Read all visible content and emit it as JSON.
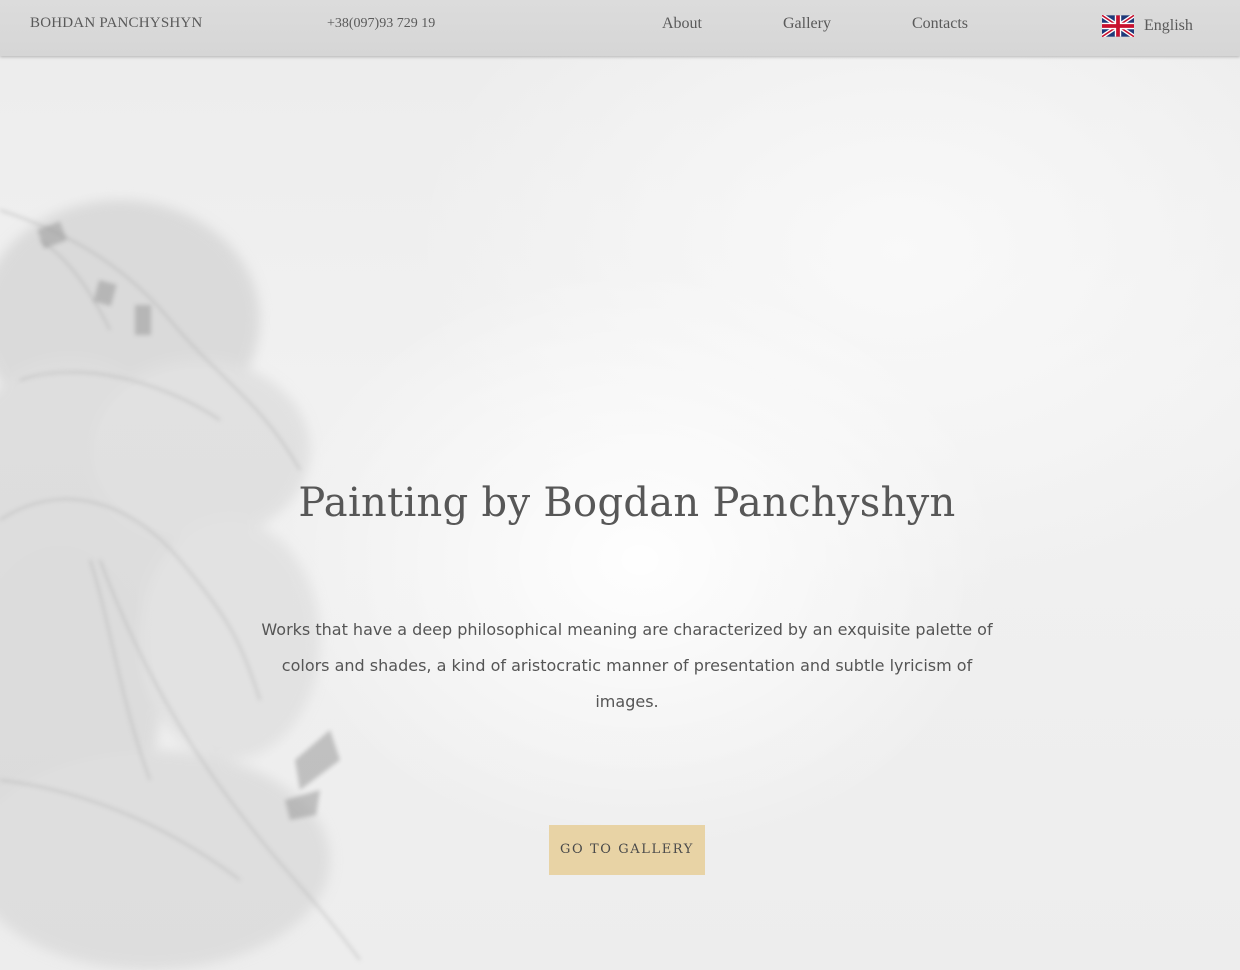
{
  "header": {
    "brand": "BOHDAN PANCHYSHYN",
    "phone": "+38(097)93 729 19",
    "nav": [
      {
        "label": "About"
      },
      {
        "label": "Gallery"
      },
      {
        "label": "Contacts"
      }
    ],
    "language": {
      "label": "English",
      "icon": "uk-flag-icon"
    }
  },
  "hero": {
    "title": "Painting by Bogdan Panchyshyn",
    "text": "Works that have a deep philosophical meaning are characterized by an exquisite palette of colors and shades, a kind of aristocratic manner of presentation and subtle lyricism of images.",
    "cta_label": "GO TO GALLERY"
  },
  "colors": {
    "header_bg": "#d9d9d9",
    "cta_bg": "#e8d3a5",
    "text": "#555555"
  }
}
